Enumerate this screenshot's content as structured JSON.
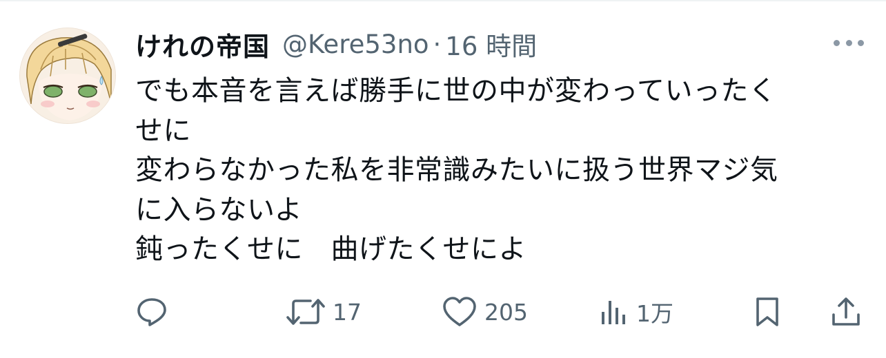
{
  "tweet": {
    "display_name": "けれの帝国",
    "handle": "@Kere53no",
    "separator": "·",
    "time": "16 時間",
    "lines": [
      "でも本音を言えば勝手に世の中が変わっていったく",
      "せに",
      "変わらなかった私を非常識みたいに扱う世界マジ気",
      "に入らないよ",
      "鈍ったくせに　曲げたくせによ"
    ]
  },
  "actions": {
    "reply": {
      "icon": "reply-icon",
      "count": ""
    },
    "repost": {
      "icon": "repost-icon",
      "count": "17"
    },
    "like": {
      "icon": "heart-icon",
      "count": "205"
    },
    "views": {
      "icon": "views-icon",
      "count": "1万"
    },
    "bookmark": {
      "icon": "bookmark-icon"
    },
    "share": {
      "icon": "share-icon"
    }
  },
  "colors": {
    "text": "#0f1419",
    "secondary": "#536471",
    "more_dots": "#8b98a5",
    "divider": "#eff3f4"
  }
}
